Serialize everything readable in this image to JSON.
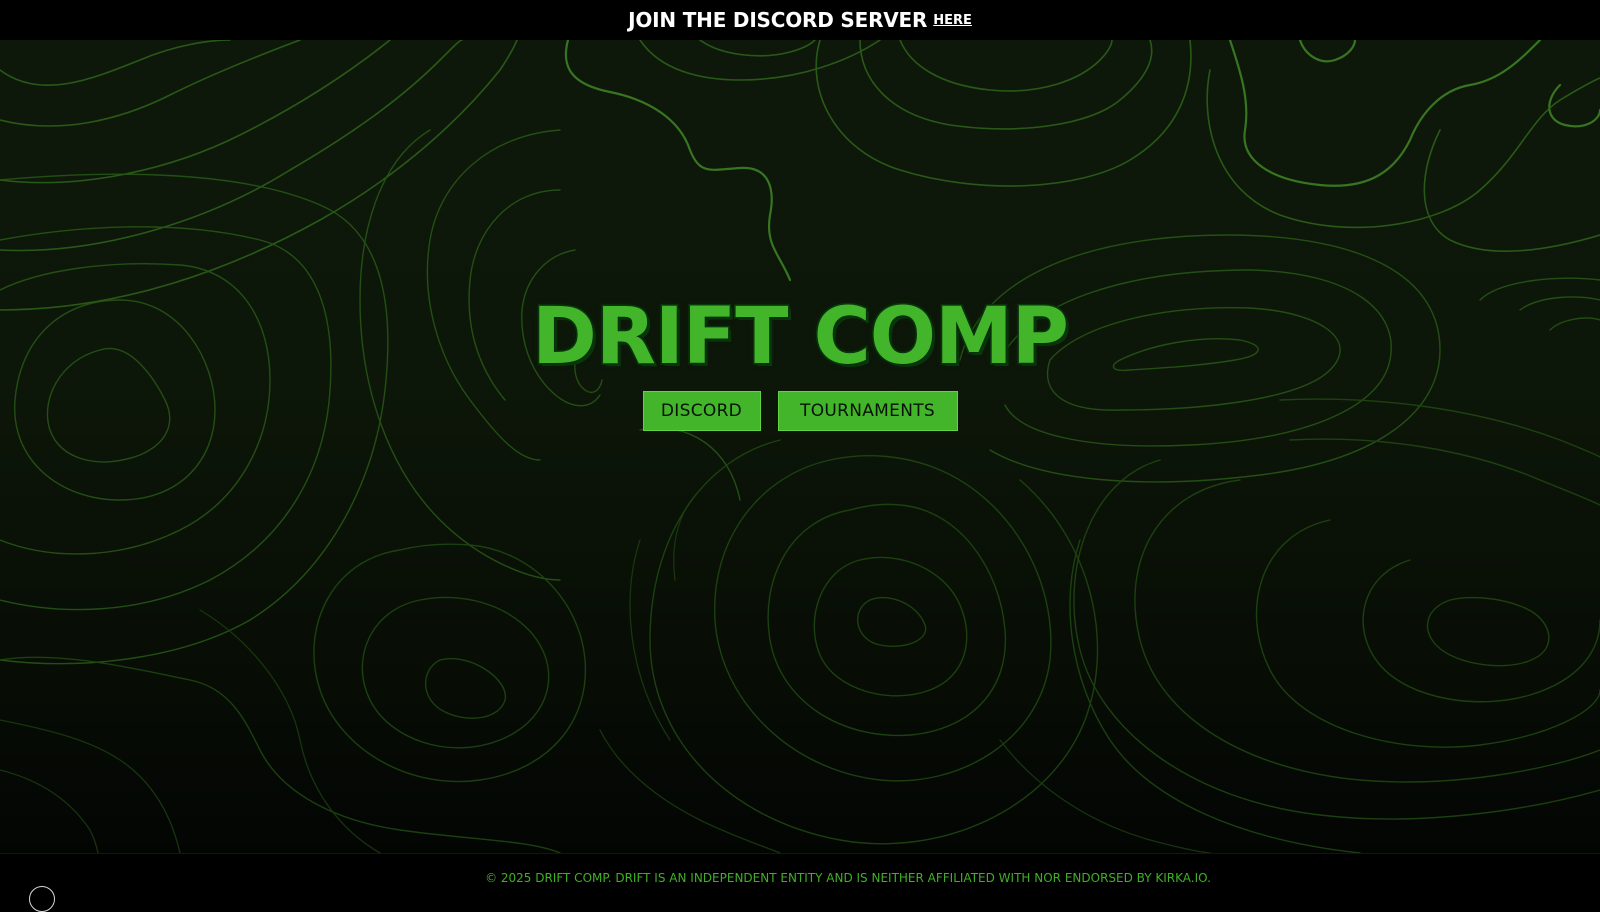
{
  "banner": {
    "text": "JOIN THE DISCORD SERVER",
    "link_label": "HERE"
  },
  "hero": {
    "title": "DRIFT COMP",
    "buttons": [
      {
        "label": "DISCORD"
      },
      {
        "label": "TOURNAMENTS"
      }
    ]
  },
  "footer": {
    "text": "© 2025 DRIFT COMP. DRIFT IS AN INDEPENDENT ENTITY AND IS NEITHER AFFILIATED WITH NOR ENDORSED BY KIRKA.IO."
  },
  "colors": {
    "accent": "#43b52a",
    "banner_bg": "#000000",
    "hero_bg": "#0e180a",
    "contour": "#2f6a1f"
  },
  "icons": {
    "corner": "circle-icon"
  }
}
